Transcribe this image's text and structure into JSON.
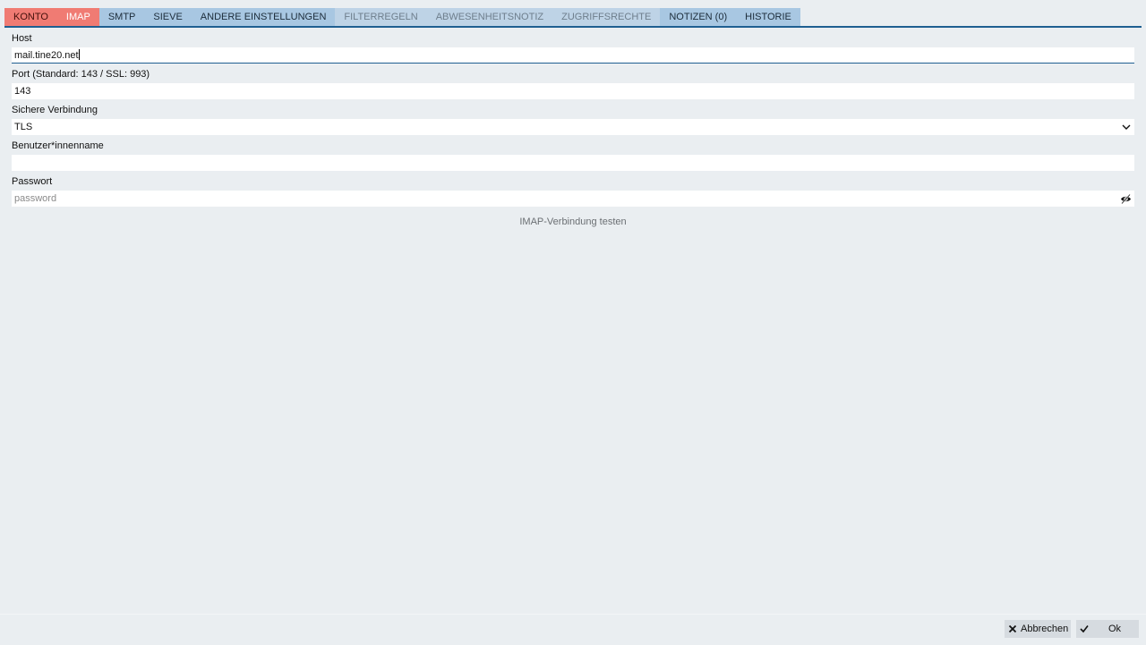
{
  "tabs": [
    {
      "label": "KONTO",
      "state": "error"
    },
    {
      "label": "IMAP",
      "state": "error-active"
    },
    {
      "label": "SMTP",
      "state": "normal"
    },
    {
      "label": "SIEVE",
      "state": "normal"
    },
    {
      "label": "ANDERE EINSTELLUNGEN",
      "state": "normal"
    },
    {
      "label": "FILTERREGELN",
      "state": "disabled"
    },
    {
      "label": "ABWESENHEITSNOTIZ",
      "state": "disabled"
    },
    {
      "label": "ZUGRIFFSRECHTE",
      "state": "disabled"
    },
    {
      "label": "NOTIZEN (0)",
      "state": "normal"
    },
    {
      "label": "HISTORIE",
      "state": "normal"
    }
  ],
  "form": {
    "host": {
      "label": "Host",
      "value": "mail.tine20.net"
    },
    "port": {
      "label": "Port (Standard: 143 / SSL: 993)",
      "value": "143"
    },
    "secure": {
      "label": "Sichere Verbindung",
      "value": "TLS"
    },
    "username": {
      "label": "Benutzer*innenname",
      "value": ""
    },
    "password": {
      "label": "Passwort",
      "placeholder": "password",
      "value": ""
    }
  },
  "test_link": "IMAP-Verbindung testen",
  "footer": {
    "cancel_label": "Abbrechen",
    "ok_label": "Ok"
  },
  "colors": {
    "tab_error": "#f07b73",
    "tab_normal": "#a8c7e2",
    "tab_disabled": "#bed3e6",
    "accent": "#1f5f91",
    "background": "#eaeef1"
  }
}
